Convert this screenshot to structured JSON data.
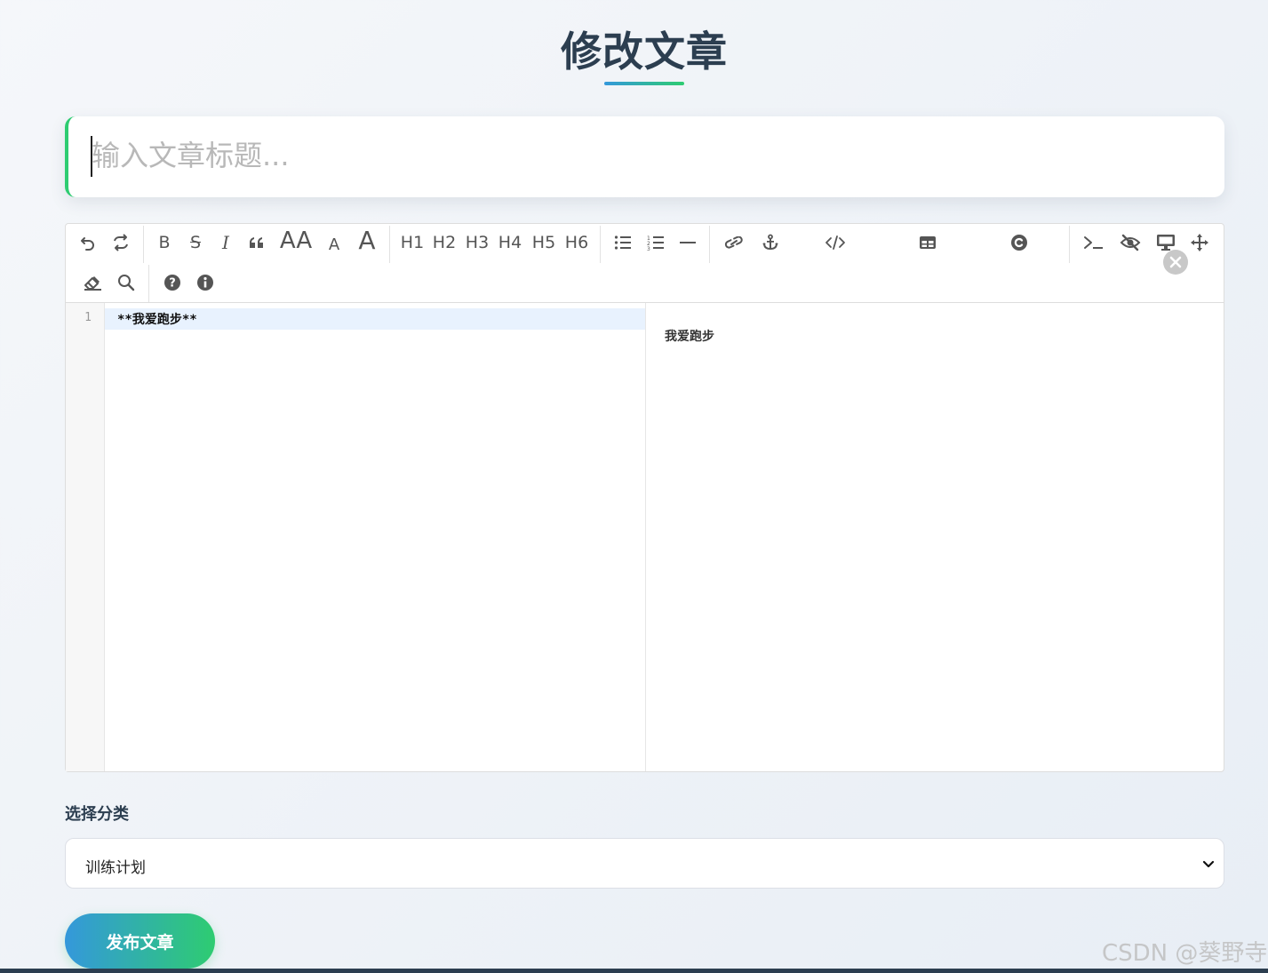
{
  "page": {
    "title": "修改文章"
  },
  "title_input": {
    "placeholder": "输入文章标题...",
    "value": ""
  },
  "toolbar": {
    "row1": [
      {
        "name": "undo-icon"
      },
      {
        "name": "redo-icon"
      },
      {
        "name": "bold-icon",
        "label": "B"
      },
      {
        "name": "strikethrough-icon",
        "label": "S"
      },
      {
        "name": "italic-icon",
        "label": "I"
      },
      {
        "name": "quote-icon"
      },
      {
        "name": "uppercase-icon",
        "label": "AA"
      },
      {
        "name": "lowercase-icon",
        "label": "A"
      },
      {
        "name": "font-size-icon",
        "label": "A"
      },
      {
        "name": "h1-icon",
        "label": "H1"
      },
      {
        "name": "h2-icon",
        "label": "H2"
      },
      {
        "name": "h3-icon",
        "label": "H3"
      },
      {
        "name": "h4-icon",
        "label": "H4"
      },
      {
        "name": "h5-icon",
        "label": "H5"
      },
      {
        "name": "h6-icon",
        "label": "H6"
      },
      {
        "name": "unordered-list-icon"
      },
      {
        "name": "ordered-list-icon"
      },
      {
        "name": "horizontal-rule-icon"
      },
      {
        "name": "link-icon"
      },
      {
        "name": "anchor-icon"
      },
      {
        "name": "code-icon"
      },
      {
        "name": "table-icon"
      },
      {
        "name": "copyright-icon"
      },
      {
        "name": "terminal-icon"
      },
      {
        "name": "hide-preview-icon"
      },
      {
        "name": "desktop-preview-icon"
      },
      {
        "name": "fullscreen-move-icon"
      }
    ],
    "row2": [
      {
        "name": "eraser-icon"
      },
      {
        "name": "search-icon"
      },
      {
        "name": "help-icon"
      },
      {
        "name": "info-icon"
      }
    ]
  },
  "editor": {
    "line_numbers": [
      "1"
    ],
    "code_lines": [
      "**我爱跑步**"
    ],
    "preview_text": "我爱跑步"
  },
  "category": {
    "label": "选择分类",
    "selected": "训练计划"
  },
  "publish_button": {
    "label": "发布文章"
  },
  "watermark": "CSDN @葵野寺",
  "colors": {
    "accent_blue": "#3498db",
    "accent_green": "#2ecc71",
    "heading": "#2c3e50"
  }
}
